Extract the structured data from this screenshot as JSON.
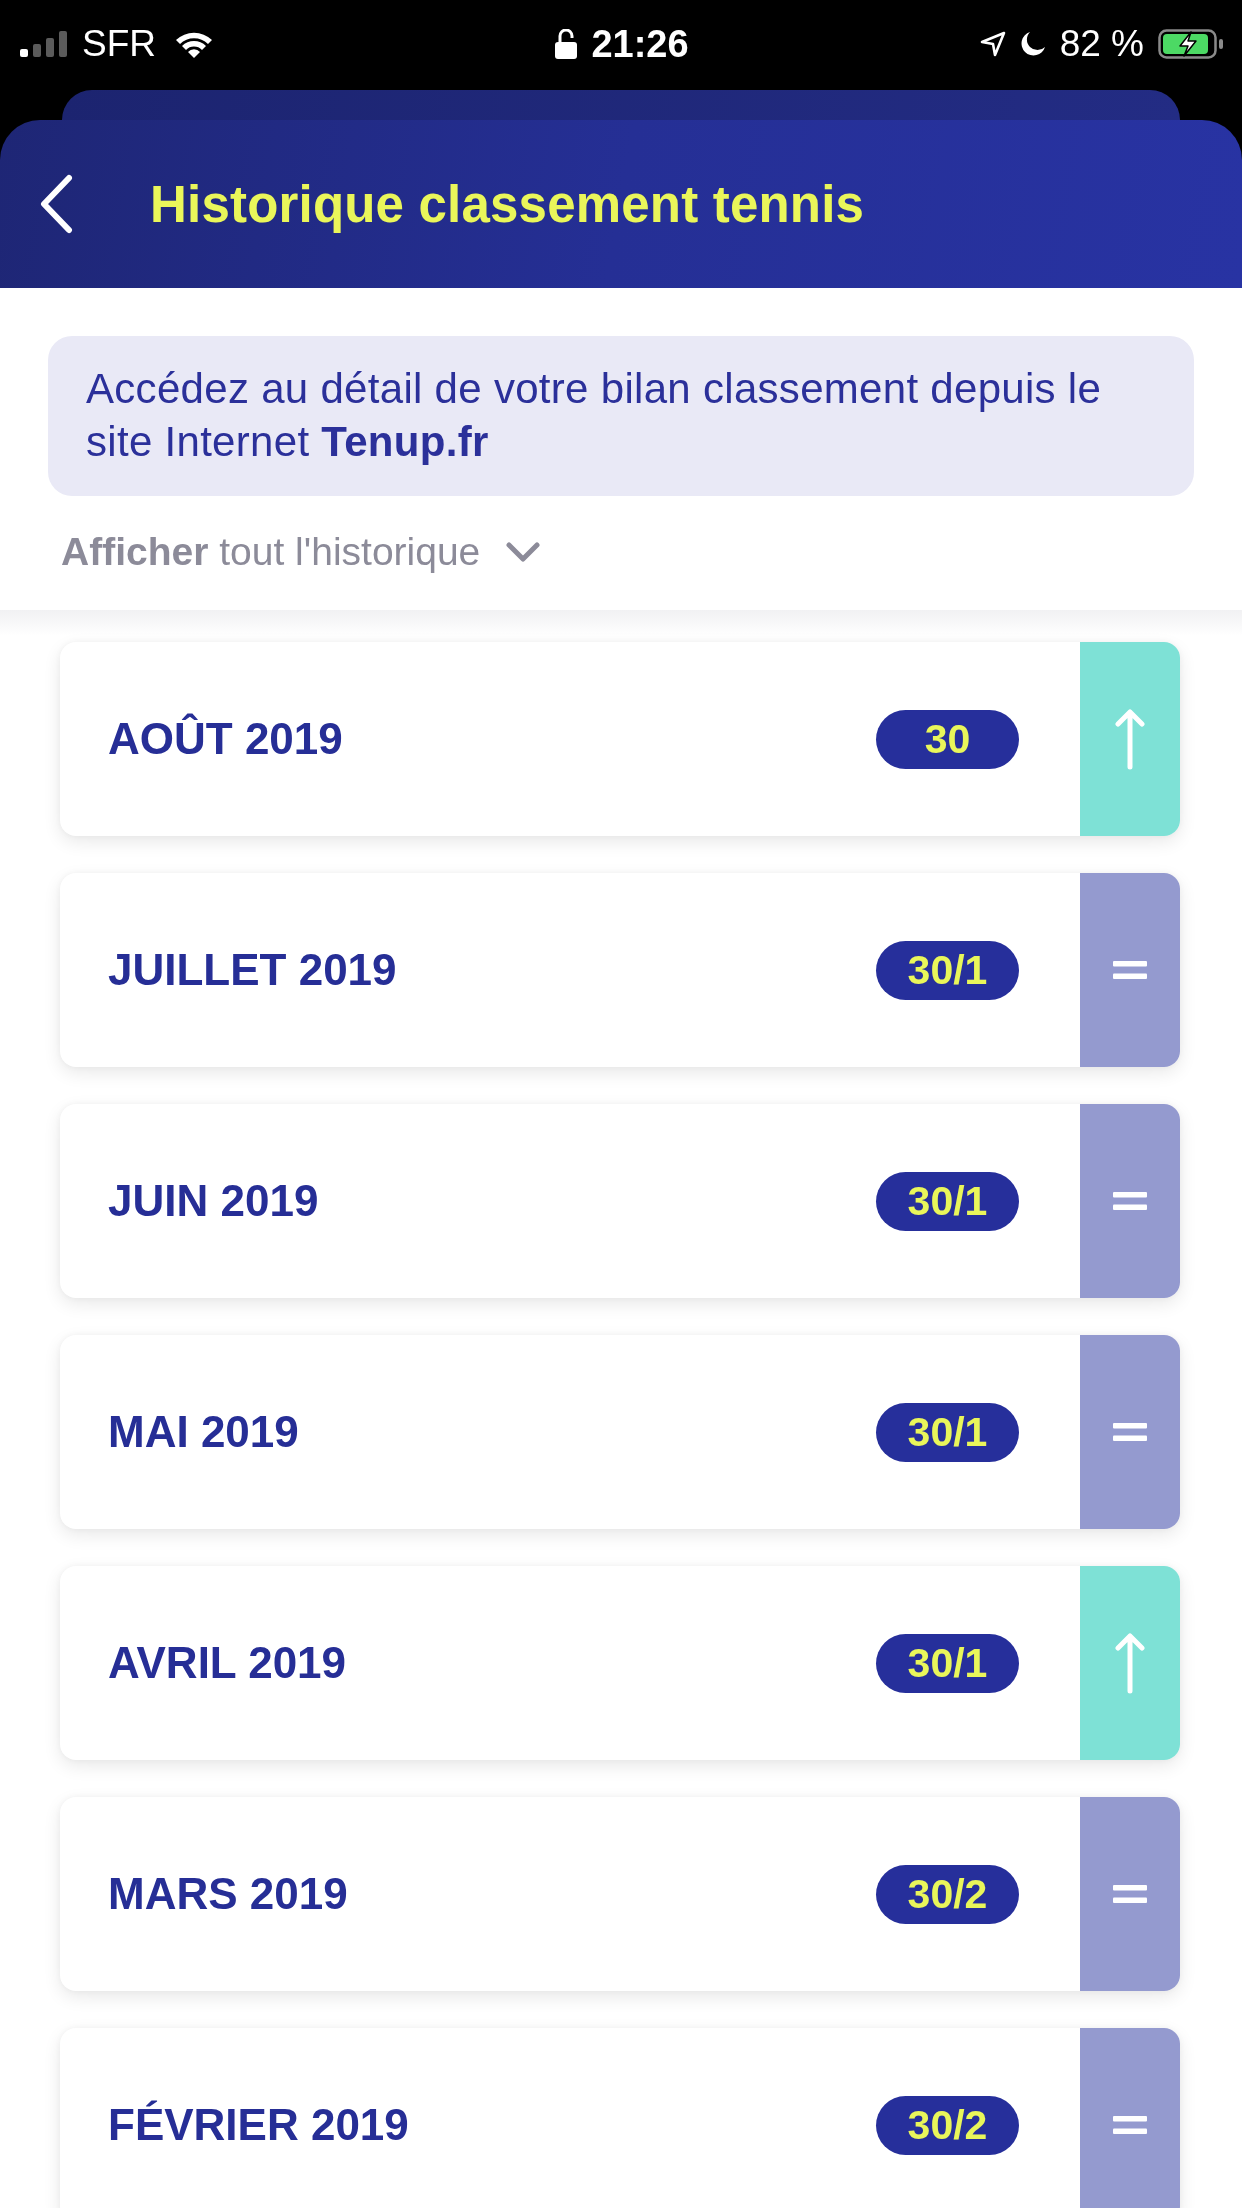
{
  "status_bar": {
    "carrier": "SFR",
    "time": "21:26",
    "battery_percent": "82 %"
  },
  "header": {
    "title": "Historique classement tennis"
  },
  "info_banner": {
    "text": "Accédez au détail de votre bilan classement depuis le site Internet **Tenup.fr**"
  },
  "history_toggle": {
    "label": "**Afficher** tout l'historique"
  },
  "months": [
    {
      "month": "AOÛT 2019",
      "ranking": "30",
      "kind": "up"
    },
    {
      "month": "JUILLET 2019",
      "ranking": "30/1",
      "kind": "same"
    },
    {
      "month": "JUIN 2019",
      "ranking": "30/1",
      "kind": "same"
    },
    {
      "month": "MAI 2019",
      "ranking": "30/1",
      "kind": "same"
    },
    {
      "month": "AVRIL 2019",
      "ranking": "30/1",
      "kind": "up"
    },
    {
      "month": "MARS 2019",
      "ranking": "30/2",
      "kind": "same"
    },
    {
      "month": "FÉVRIER 2019",
      "ranking": "30/2",
      "kind": "same"
    }
  ]
}
